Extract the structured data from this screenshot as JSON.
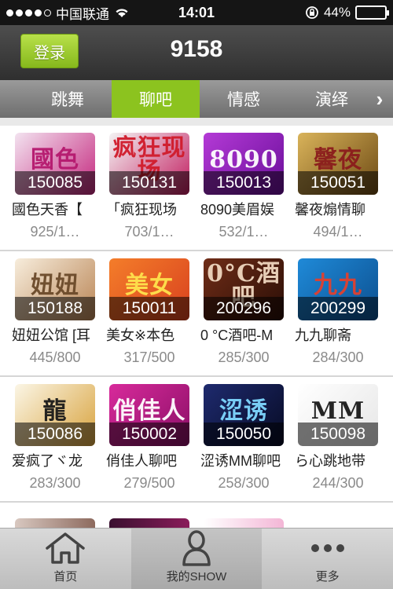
{
  "status_bar": {
    "carrier": "中国联通",
    "time": "14:01",
    "battery_percent": "44%",
    "battery_level": 0.44,
    "signal_bars_filled": 4
  },
  "header": {
    "login_label": "登录",
    "title": "9158"
  },
  "tabs": [
    {
      "label": "跳舞",
      "active": false
    },
    {
      "label": "聊吧",
      "active": true
    },
    {
      "label": "情感",
      "active": false
    },
    {
      "label": "演绎",
      "active": false
    }
  ],
  "rooms": [
    [
      {
        "id": "150085",
        "name": "國色天香【",
        "count": "925/1…",
        "art": "國色",
        "color1": "#f3e3f0",
        "color2": "#c4267d",
        "artColor": "#b5186e"
      },
      {
        "id": "150131",
        "name": "「疯狂现场",
        "count": "703/1…",
        "art": "疯狂现场",
        "color1": "#f4f4f4",
        "color2": "#c11b5e",
        "artColor": "#d01b2b"
      },
      {
        "id": "150013",
        "name": "8090美眉娱",
        "count": "532/1…",
        "art": "8090",
        "color1": "#b43ad6",
        "color2": "#6a0e9a",
        "artColor": "#ffffff"
      },
      {
        "id": "150051",
        "name": "馨夜煽情聊",
        "count": "494/1…",
        "art": "馨夜",
        "color1": "#d9b35a",
        "color2": "#6d4a14",
        "artColor": "#8b1c1c"
      }
    ],
    [
      {
        "id": "150188",
        "name": "妞妞公馆 [耳",
        "count": "445/800",
        "art": "妞妞",
        "color1": "#f7eddc",
        "color2": "#b98454",
        "artColor": "#6b4a2a"
      },
      {
        "id": "150011",
        "name": "美女※本色",
        "count": "317/500",
        "art": "美女",
        "color1": "#f47d2a",
        "color2": "#d8411e",
        "artColor": "#ffe34d"
      },
      {
        "id": "200296",
        "name": "0 °C酒吧-M",
        "count": "285/300",
        "art": "0°C酒吧",
        "color1": "#6f2c17",
        "color2": "#2a0e06",
        "artColor": "#f0d7c0"
      },
      {
        "id": "200299",
        "name": "九九聊斋",
        "count": "284/300",
        "art": "九九",
        "color1": "#1f8ad8",
        "color2": "#0c4f8f",
        "artColor": "#e2402e"
      }
    ],
    [
      {
        "id": "150086",
        "name": "爱疯了ヾ龙",
        "count": "283/300",
        "art": "龍",
        "color1": "#fbf6e6",
        "color2": "#d8a23c",
        "artColor": "#1a1a1a"
      },
      {
        "id": "150002",
        "name": "俏佳人聊吧",
        "count": "279/500",
        "art": "俏佳人",
        "color1": "#d82a9b",
        "color2": "#8a0f66",
        "artColor": "#ffffff"
      },
      {
        "id": "150050",
        "name": "涩诱MM聊吧",
        "count": "258/300",
        "art": "涩诱",
        "color1": "#1e2a6e",
        "color2": "#070b24",
        "artColor": "#7fd7ff"
      },
      {
        "id": "150098",
        "name": "ら心跳地带",
        "count": "244/300",
        "art": "MM",
        "color1": "#ffffff",
        "color2": "#e6e6e6",
        "artColor": "#1a1a1a"
      }
    ]
  ],
  "bottom_nav": [
    {
      "label": "首页",
      "icon": "home-icon",
      "active": false
    },
    {
      "label": "我的SHOW",
      "icon": "person-icon",
      "active": true
    },
    {
      "label": "更多",
      "icon": "more-icon",
      "active": false
    }
  ]
}
